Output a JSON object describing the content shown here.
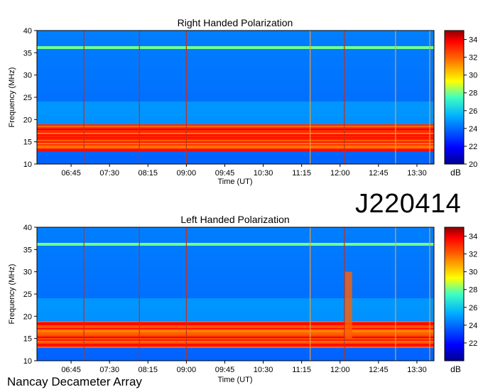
{
  "colors": {
    "colormap": [
      "#00008f",
      "#0000ff",
      "#0080ff",
      "#00ffff",
      "#80ff80",
      "#ffff00",
      "#ff8000",
      "#ff0000",
      "#800000"
    ],
    "vertical_marker_orange": "#e8a040",
    "vertical_marker_red": "#c03020"
  },
  "station_label": "J220414",
  "observatory_label": "Nancay Decameter Array",
  "chart_data": [
    {
      "type": "heatmap",
      "title": "Right Handed Polarization",
      "xlabel": "Time (UT)",
      "ylabel": "Frequency (MHz)",
      "xlim": [
        "06:05",
        "13:50"
      ],
      "ylim": [
        10,
        40
      ],
      "xticks": [
        "06:45",
        "07:30",
        "08:15",
        "09:00",
        "09:45",
        "10:30",
        "11:15",
        "12:00",
        "12:45",
        "13:30"
      ],
      "yticks": [
        10,
        15,
        20,
        25,
        30,
        35,
        40
      ],
      "colorbar": {
        "label": "dB",
        "range": [
          20,
          35
        ],
        "ticks": [
          20,
          22,
          24,
          26,
          28,
          30,
          32,
          34
        ]
      },
      "vertical_lines": [
        {
          "time": "07:00",
          "color": "red"
        },
        {
          "time": "08:05",
          "color": "red"
        },
        {
          "time": "09:00",
          "color": "red"
        },
        {
          "time": "11:25",
          "color": "orange"
        },
        {
          "time": "12:05",
          "color": "red"
        },
        {
          "time": "13:05",
          "color": "orange"
        },
        {
          "time": "13:45",
          "color": "orange"
        }
      ],
      "features": [
        {
          "name": "strong emission band",
          "freq_range": [
            13,
            19
          ],
          "level_db": 33
        },
        {
          "name": "narrow band interference",
          "freq": 36.2,
          "level_db": 28
        },
        {
          "name": "noise floor below 12 MHz",
          "freq_range": [
            10,
            12
          ],
          "level_db": 21
        }
      ]
    },
    {
      "type": "heatmap",
      "title": "Left Handed Polarization",
      "xlabel": "Time (UT)",
      "ylabel": "Frequency (MHz)",
      "xlim": [
        "06:05",
        "13:50"
      ],
      "ylim": [
        10,
        40
      ],
      "xticks": [
        "06:45",
        "07:30",
        "08:15",
        "09:00",
        "09:45",
        "10:30",
        "11:15",
        "12:00",
        "12:45",
        "13:30"
      ],
      "yticks": [
        10,
        15,
        20,
        25,
        30,
        35,
        40
      ],
      "colorbar": {
        "label": "dB",
        "range": [
          20,
          35
        ],
        "ticks": [
          22,
          24,
          26,
          28,
          30,
          32,
          34
        ]
      },
      "vertical_lines": [
        {
          "time": "07:00",
          "color": "red"
        },
        {
          "time": "08:05",
          "color": "red"
        },
        {
          "time": "09:00",
          "color": "red"
        },
        {
          "time": "11:25",
          "color": "orange"
        },
        {
          "time": "12:05",
          "color": "red"
        },
        {
          "time": "13:05",
          "color": "orange"
        },
        {
          "time": "13:45",
          "color": "orange"
        }
      ],
      "features": [
        {
          "name": "strong emission band",
          "freq_range": [
            13,
            19
          ],
          "level_db": 33
        },
        {
          "name": "narrow band interference",
          "freq": 36.2,
          "level_db": 28
        },
        {
          "name": "noise floor below 12 MHz",
          "freq_range": [
            10,
            12
          ],
          "level_db": 21
        },
        {
          "name": "burst near 12:10",
          "time": "12:10",
          "freq_range": [
            15,
            30
          ],
          "level_db": 32
        }
      ]
    }
  ]
}
